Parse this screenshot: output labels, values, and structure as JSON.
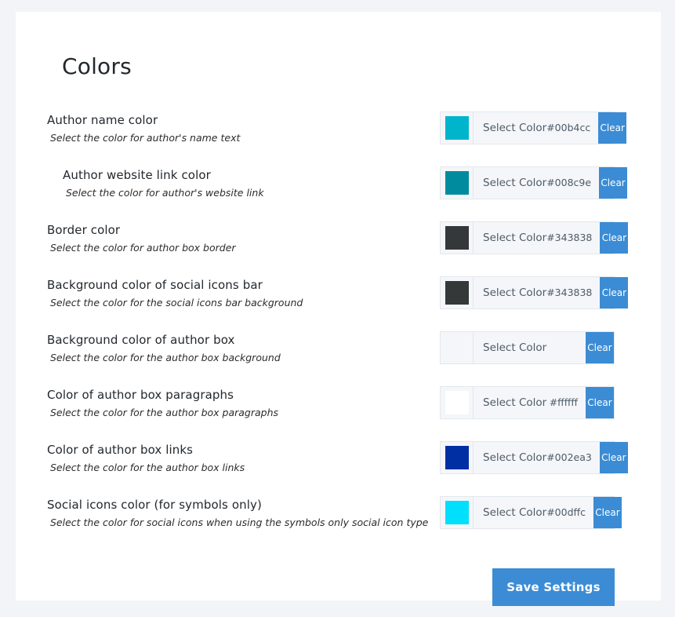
{
  "page": {
    "title": "Colors",
    "background_color": "#f2f4f8",
    "card_color": "#ffffff",
    "accent_color": "#3b8cd4"
  },
  "picker": {
    "select_label": "Select Color",
    "clear_label": "Clear"
  },
  "settings": [
    {
      "title": "Author name color",
      "description": "Select the color for author's name text",
      "value": "#00b4cc",
      "swatch": "#00b4cc",
      "indented": false
    },
    {
      "title": "Author website link color",
      "description": "Select the color for author's website link",
      "value": "#008c9e",
      "swatch": "#008c9e",
      "indented": true
    },
    {
      "title": "Border color",
      "description": "Select the color for author box border",
      "value": "#343838",
      "swatch": "#343838",
      "indented": false
    },
    {
      "title": "Background color of social icons bar",
      "description": "Select the color for the social icons bar background",
      "value": "#343838",
      "swatch": "#343838",
      "indented": false
    },
    {
      "title": "Background color of author box",
      "description": "Select the color for the author box background",
      "value": "",
      "swatch": "",
      "indented": false
    },
    {
      "title": "Color of author box paragraphs",
      "description": "Select the color for the author box paragraphs",
      "value": "#ffffff",
      "swatch": "#ffffff",
      "indented": false
    },
    {
      "title": "Color of author box links",
      "description": "Select the color for the author box links",
      "value": "#002ea3",
      "swatch": "#002ea3",
      "indented": false
    },
    {
      "title": "Social icons color (for symbols only)",
      "description": "Select the color for social icons when using the symbols only social icon type",
      "value": "#00dffc",
      "swatch": "#00dffc",
      "indented": false
    }
  ],
  "footer": {
    "save_label": "Save Settings"
  }
}
